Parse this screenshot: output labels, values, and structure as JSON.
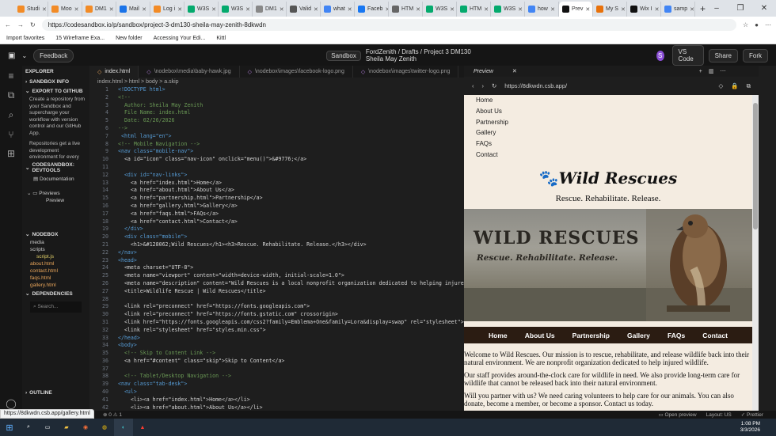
{
  "browser": {
    "tabs": [
      {
        "label": "Studi",
        "color": "#f28b26"
      },
      {
        "label": "Moo",
        "color": "#f28b26"
      },
      {
        "label": "DM1",
        "color": "#f28b26"
      },
      {
        "label": "Mail",
        "color": "#1a73e8"
      },
      {
        "label": "Log i",
        "color": "#f28b26"
      },
      {
        "label": "W3S",
        "color": "#04aa6d"
      },
      {
        "label": "W3S",
        "color": "#04aa6d"
      },
      {
        "label": "DM1",
        "color": "#888888"
      },
      {
        "label": "Valid",
        "color": "#555555"
      },
      {
        "label": "what",
        "color": "#4285f4"
      },
      {
        "label": "Faceb",
        "color": "#1877f2"
      },
      {
        "label": "HTM",
        "color": "#666666"
      },
      {
        "label": "W3S",
        "color": "#04aa6d"
      },
      {
        "label": "HTM",
        "color": "#04aa6d"
      },
      {
        "label": "W3S",
        "color": "#04aa6d"
      },
      {
        "label": "how",
        "color": "#4285f4"
      },
      {
        "label": "Prev",
        "color": "#111111",
        "active": true
      },
      {
        "label": "My S",
        "color": "#e8710a"
      },
      {
        "label": "Wix I",
        "color": "#111111"
      },
      {
        "label": "samp",
        "color": "#4285f4"
      }
    ],
    "new_tab": "+",
    "window_controls": [
      "–",
      "❐",
      "✕"
    ],
    "url": "https://codesandbox.io/p/sandbox/project-3-dm130-sheila-may-zenith-8dkwdn",
    "bookmarks": [
      "Import favorites",
      "15 Wireframe Exa...",
      "New folder",
      "Accessing Your Edi...",
      "Kittl"
    ]
  },
  "csb": {
    "feedback": "Feedback",
    "sandbox_badge": "Sandbox",
    "breadcrumb": "FordZenith / Drafts / Project 3 DM130 Sheila May Zenith",
    "avatar": "S",
    "vscode": "VS Code",
    "share": "Share",
    "fork": "Fork"
  },
  "sidebar": {
    "explorer": "EXPLORER",
    "sandbox_info": "SANDBOX INFO",
    "export": "EXPORT TO GITHUB",
    "export_text": "Create a repository from your Sandbox and supercharge your workflow with version control and our GitHub App.",
    "repo_text": "Repositories get a live development environment for every PR, deployment previews, branches, databases and much more",
    "devtools": "CODESANDBOX: DEVTOOLS",
    "documentation": "Documentation",
    "previews": "Previews",
    "preview": "Preview",
    "nodebox": "NODEBOX",
    "files": [
      "media",
      "scripts",
      "script.js",
      "about.html",
      "contact.html",
      "faqs.html",
      "gallery.html"
    ],
    "dependencies": "DEPENDENCIES",
    "search": "Search...",
    "outline": "OUTLINE"
  },
  "editor": {
    "tabs": [
      "index.html",
      "\\nodebox\\media\\baby-hawk.jpg",
      "\\nodebox\\images\\facebook-logo.png",
      "\\nodebox\\images\\twitter-logo.png"
    ],
    "crumbs": "index.html > html > body > a.skip",
    "lines": [
      {
        "n": "1",
        "t": "<!DOCTYPE html>",
        "c": "tag"
      },
      {
        "n": "2",
        "t": "<!--",
        "c": "cmt"
      },
      {
        "n": "3",
        "t": "  Author: Sheila May Zenith",
        "c": "cmt"
      },
      {
        "n": "4",
        "t": "  File Name: index.html",
        "c": "cmt"
      },
      {
        "n": "5",
        "t": "  Date: 02/26/2026",
        "c": "cmt"
      },
      {
        "n": "6",
        "t": "-->",
        "c": "cmt"
      },
      {
        "n": "7",
        "t": " <html lang=\"en\">",
        "c": "tag"
      },
      {
        "n": "8",
        "t": "<!-- Mobile Navigation -->",
        "c": "cmt"
      },
      {
        "n": "9",
        "t": "<nav class=\"mobile-nav\">",
        "c": "tag"
      },
      {
        "n": "10",
        "t": "  <a id=\"icon\" class=\"nav-icon\" onclick=\"menu()\">&#9776;</a>",
        "c": "ct"
      },
      {
        "n": "11",
        "t": "",
        "c": "ct"
      },
      {
        "n": "12",
        "t": "  <div id=\"nav-links\">",
        "c": "tag"
      },
      {
        "n": "13",
        "t": "    <a href=\"index.html\">Home</a>",
        "c": "ct"
      },
      {
        "n": "14",
        "t": "    <a href=\"about.html\">About Us</a>",
        "c": "ct"
      },
      {
        "n": "15",
        "t": "    <a href=\"partnership.html\">Partnership</a>",
        "c": "ct"
      },
      {
        "n": "16",
        "t": "    <a href=\"gallery.html\">Gallery</a>",
        "c": "ct"
      },
      {
        "n": "17",
        "t": "    <a href=\"faqs.html\">FAQs</a>",
        "c": "ct"
      },
      {
        "n": "18",
        "t": "    <a href=\"contact.html\">Contact</a>",
        "c": "ct"
      },
      {
        "n": "19",
        "t": "  </div>",
        "c": "tag"
      },
      {
        "n": "20",
        "t": "  <div class=\"mobile\">",
        "c": "tag"
      },
      {
        "n": "21",
        "t": "    <h1>&#128062;Wild Rescues</h1><h3>Rescue. Rehabilitate. Release.</h3></div>",
        "c": "ct"
      },
      {
        "n": "22",
        "t": "</nav>",
        "c": "tag"
      },
      {
        "n": "23",
        "t": "<head>",
        "c": "tag"
      },
      {
        "n": "24",
        "t": "  <meta charset=\"UTF-8\">",
        "c": "ct"
      },
      {
        "n": "25",
        "t": "  <meta name=\"viewport\" content=\"width=device-width, initial-scale=1.0\">",
        "c": "ct"
      },
      {
        "n": "26",
        "t": "  <meta name=\"description\" content=\"Wild Rescues is a local nonprofit organization dedicated to helping injured",
        "c": "ct"
      },
      {
        "n": "27",
        "t": "  <title>Wildlife Rescue | Wild Rescues</title>",
        "c": "ct"
      },
      {
        "n": "28",
        "t": "",
        "c": "ct"
      },
      {
        "n": "29",
        "t": "  <link rel=\"preconnect\" href=\"https://fonts.googleapis.com\">",
        "c": "ct"
      },
      {
        "n": "30",
        "t": "  <link rel=\"preconnect\" href=\"https://fonts.gstatic.com\" crossorigin>",
        "c": "ct"
      },
      {
        "n": "31",
        "t": "  <link href=\"https://fonts.googleapis.com/css2?family=Emblema+One&family=Lora&display=swap\" rel=\"stylesheet\">",
        "c": "ct"
      },
      {
        "n": "32",
        "t": "  <link rel=\"stylesheet\" href=\"styles.min.css\">",
        "c": "ct"
      },
      {
        "n": "33",
        "t": "</head>",
        "c": "tag"
      },
      {
        "n": "34",
        "t": "<body>",
        "c": "tag"
      },
      {
        "n": "35",
        "t": "  <!-- Skip to Content Link -->",
        "c": "cmt"
      },
      {
        "n": "36",
        "t": "  <a href=\"#content\" class=\"skip\">Skip to Content</a>",
        "c": "ct"
      },
      {
        "n": "37",
        "t": "",
        "c": "ct"
      },
      {
        "n": "38",
        "t": "  <!-- Tablet/Desktop Navigation -->",
        "c": "cmt"
      },
      {
        "n": "39",
        "t": "<nav class=\"tab-desk\">",
        "c": "tag"
      },
      {
        "n": "40",
        "t": "  <ul>",
        "c": "tag"
      },
      {
        "n": "41",
        "t": "    <li><a href=\"index.html\">Home</a></li>",
        "c": "ct"
      },
      {
        "n": "42",
        "t": "    <li><a href=\"about.html\">About Us</a></li>",
        "c": "ct"
      }
    ]
  },
  "preview": {
    "title": "Preview",
    "url": "https://8dkwdn.csb.app/",
    "mobile_nav": [
      "Home",
      "About Us",
      "Partnership",
      "Gallery",
      "FAQs",
      "Contact"
    ],
    "logo": "Wild Rescues",
    "tagline": "Rescue. Rehabilitate. Release.",
    "hero_title": "WILD RESCUES",
    "hero_sub": "Rescue. Rehabilitate. Release.",
    "tab_nav": [
      "Home",
      "About Us",
      "Partnership",
      "Gallery",
      "FAQs",
      "Contact"
    ],
    "paragraphs": [
      "Welcome to Wild Rescues. Our mission is to rescue, rehabilitate, and release wildlife back into their natural environment. We are nonprofit organization dedicated to help injured wildlife.",
      "Our staff provides around-the-clock care for wildlife in need. We also provide long-term care for wildlife that cannot be released back into their natural environment.",
      "Will you partner with us? We need caring volunteers to help care for our animals. You can also donate, become a member, or become a sponsor. Contact us today."
    ]
  },
  "status": {
    "hover_url": "https://8dkwdn.csb.app/gallery.html",
    "open_preview": "Open preview",
    "layout": "Layout: US",
    "prettier": "Prettier",
    "errors": "0",
    "warnings": "1"
  },
  "taskbar": {
    "time": "1:08 PM",
    "date": "3/3/2026"
  }
}
